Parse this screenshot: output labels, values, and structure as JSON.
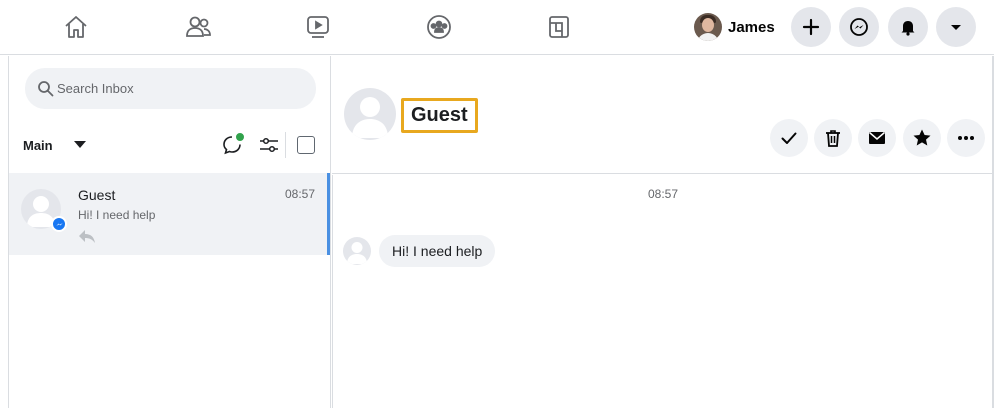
{
  "colors": {
    "accent_blue": "#1877f2",
    "highlight_border": "#e8a81f",
    "online_green": "#31a24c",
    "selected_row": "#f0f2f5"
  },
  "topnav": {
    "icons": [
      "home-icon",
      "friends-icon",
      "watch-icon",
      "groups-icon",
      "pages-icon"
    ],
    "user_name": "James",
    "actions": [
      "plus-icon",
      "messenger-icon",
      "notifications-bell-icon",
      "account-menu-caret-icon"
    ]
  },
  "inbox": {
    "search_placeholder": "Search Inbox",
    "filter_label": "Main",
    "threads": [
      {
        "name": "Guest",
        "time": "08:57",
        "preview": "Hi! I need help"
      }
    ]
  },
  "conversation": {
    "contact_name": "Guest",
    "actions": [
      "mark-done-icon",
      "trash-icon",
      "mark-unread-icon",
      "star-icon",
      "more-options-icon"
    ],
    "timestamp": "08:57",
    "messages": [
      {
        "from": "Guest",
        "text": "Hi! I need help"
      }
    ]
  }
}
